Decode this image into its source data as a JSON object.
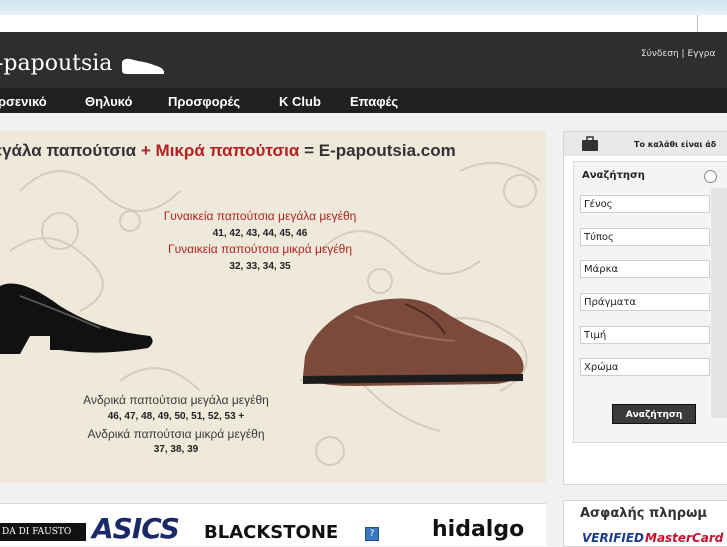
{
  "header": {
    "logo_text": "-papoutsia",
    "login_links": "Σύνδεση | Εγγρα"
  },
  "nav": {
    "items": [
      {
        "label": "ρσενικό"
      },
      {
        "label": "Θηλυκό"
      },
      {
        "label": "Προσφορές"
      },
      {
        "label": "K Club"
      },
      {
        "label": "Επαφές"
      }
    ]
  },
  "banner": {
    "title_part1": "εγάλα παπούτσια",
    "title_plus": "+",
    "title_part2": "Μικρά παπούτσια",
    "title_equals": "=",
    "title_part3": "E-papoutsia.com",
    "women_large": "Γυναικεία παπούτσια μεγάλα μεγέθη",
    "women_large_sizes": "41, 42, 43, 44, 45, 46",
    "women_small": "Γυναικεία παπούτσια μικρά μεγέθη",
    "women_small_sizes": "32, 33, 34, 35",
    "men_large": "Ανδρικά παπούτσια μεγάλα μεγέθη",
    "men_large_sizes": "46, 47, 48, 49, 50, 51, 52, 53 +",
    "men_small": "Ανδρικά παπούτσια μικρά μεγέθη",
    "men_small_sizes": "37, 38, 39"
  },
  "sidebar": {
    "cart_label": "Το καλάθι είναι άδ",
    "search_label": "Αναζήτηση",
    "fields": [
      {
        "label": "Γένος"
      },
      {
        "label": "Τύπος"
      },
      {
        "label": "Μάρκα"
      },
      {
        "label": "Πράγματα"
      },
      {
        "label": "Τιμή"
      },
      {
        "label": "Χρώμα"
      }
    ],
    "search_button": "Αναζήτηση",
    "secure_title": "Ασφαλής πληρωμ",
    "verified_label": "VERIFIED",
    "mastercard_label": "MasterCard"
  },
  "brands": {
    "items": [
      "DA DI FAUSTO",
      "ASICS",
      "BLACKSTONE",
      "hidalgo"
    ]
  },
  "colors": {
    "header_bg": "#2e2e2e",
    "nav_bg": "#202020",
    "accent_red": "#b22222"
  }
}
